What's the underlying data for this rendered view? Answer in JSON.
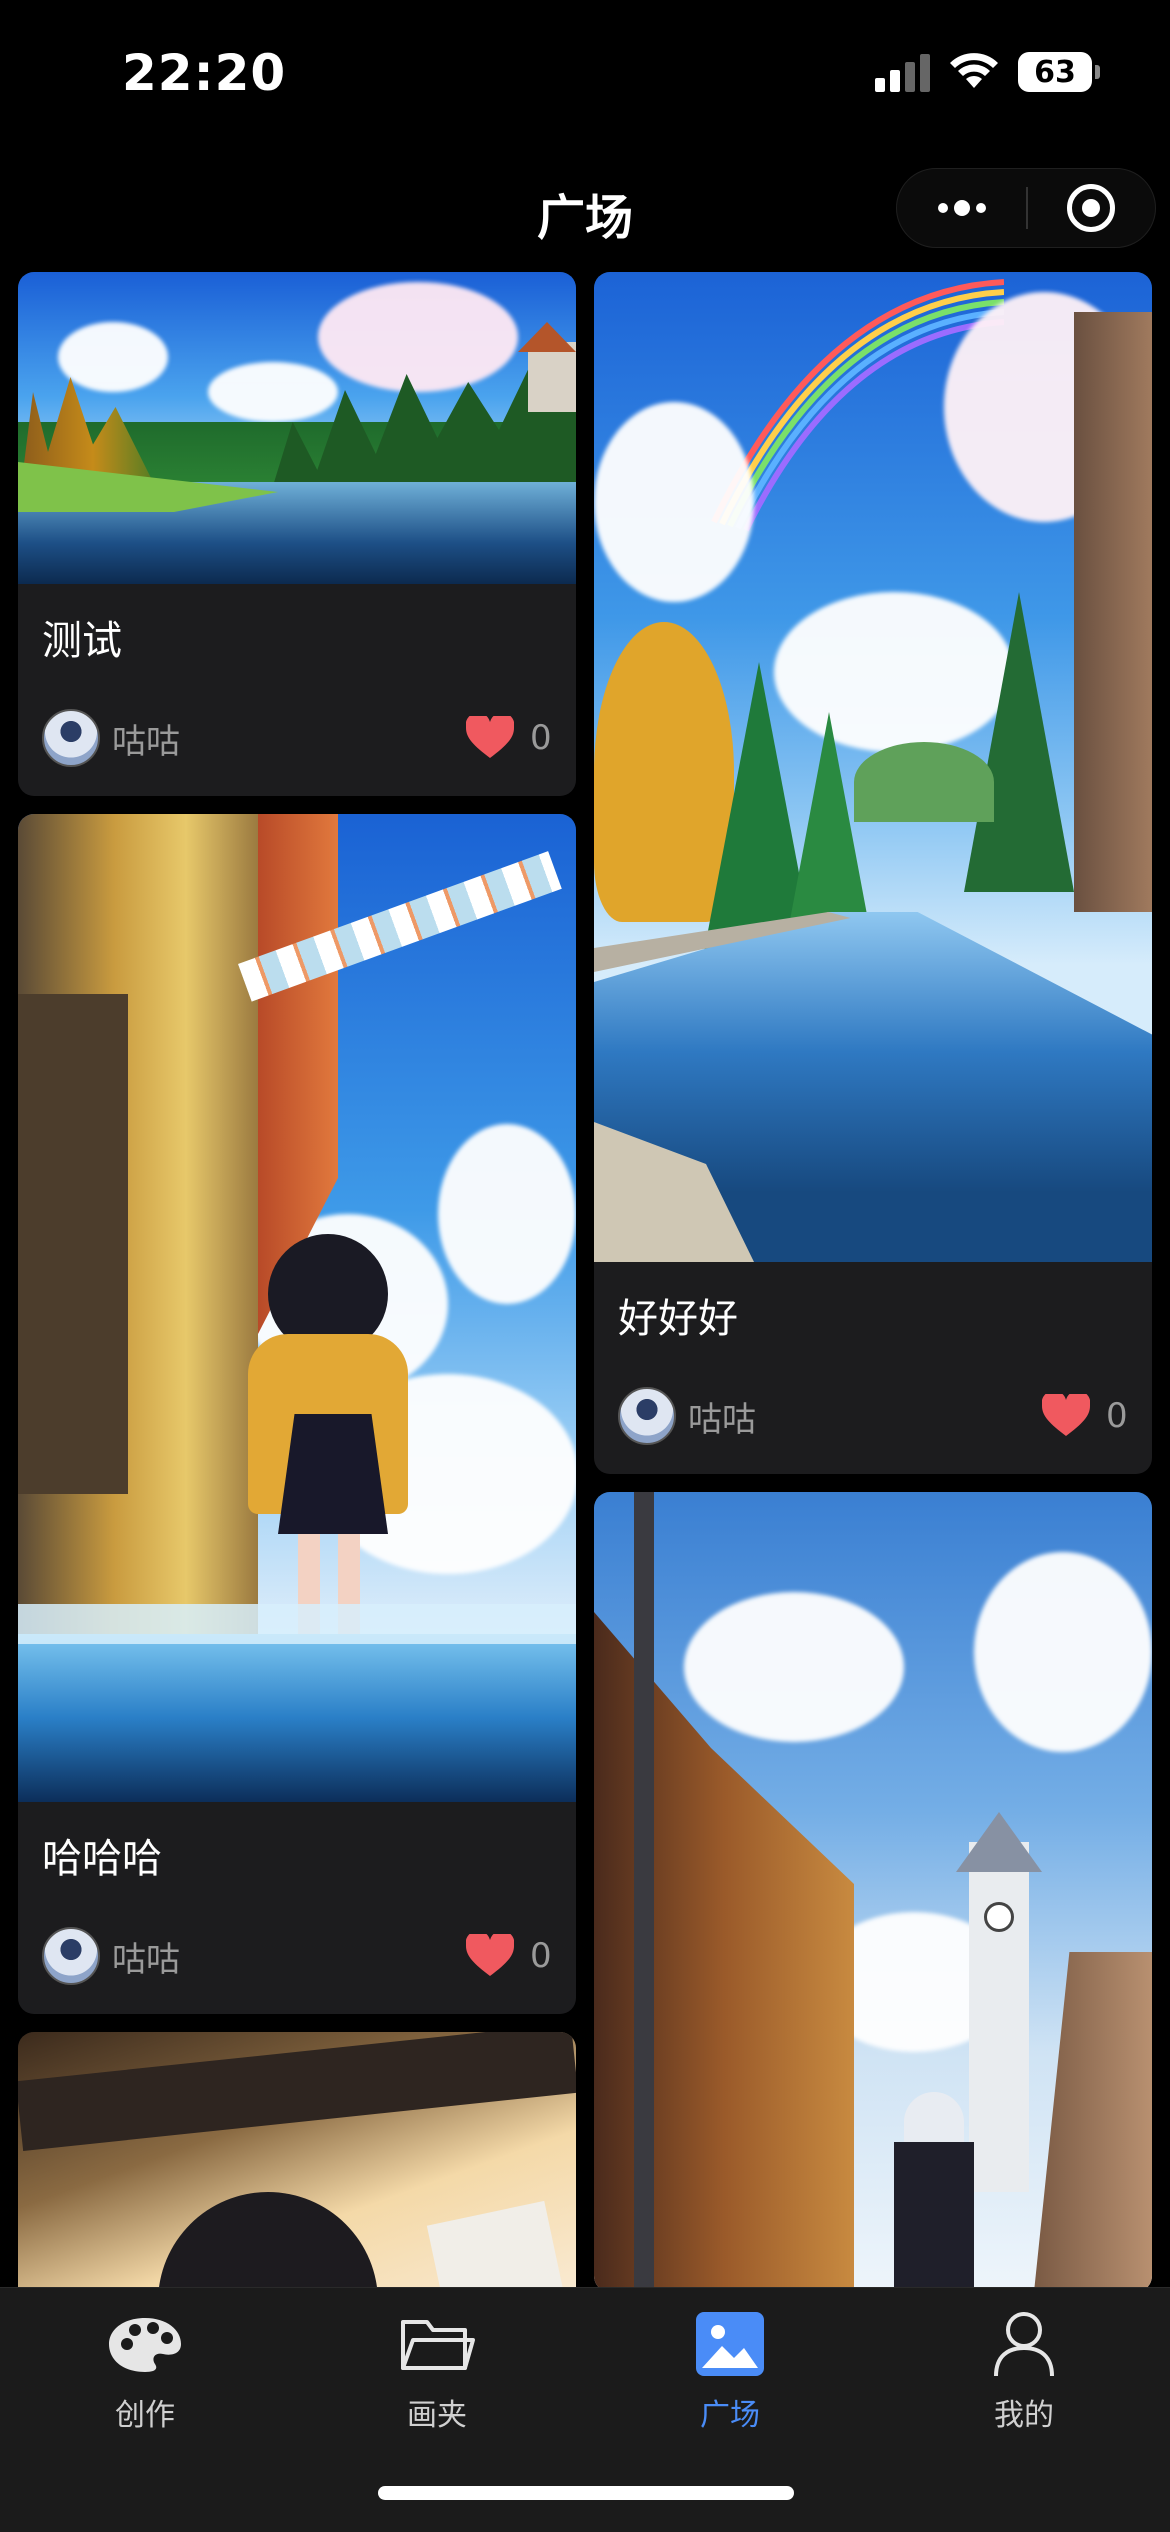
{
  "status_bar": {
    "time": "22:20",
    "battery": "63"
  },
  "header": {
    "title": "广场"
  },
  "feed": {
    "left": [
      {
        "title": "测试",
        "author": "咕咕",
        "likes": "0"
      },
      {
        "title": "哈哈哈",
        "author": "咕咕",
        "likes": "0"
      }
    ],
    "right": [
      {
        "title": "好好好",
        "author": "咕咕",
        "likes": "0"
      }
    ]
  },
  "tabs": [
    {
      "label": "创作",
      "icon": "palette-icon"
    },
    {
      "label": "画夹",
      "icon": "folder-icon"
    },
    {
      "label": "广场",
      "icon": "image-icon",
      "active": true
    },
    {
      "label": "我的",
      "icon": "user-icon"
    }
  ],
  "colors": {
    "accent": "#4a8cf7",
    "heart": "#f0595f",
    "card": "#1c1c1e"
  }
}
